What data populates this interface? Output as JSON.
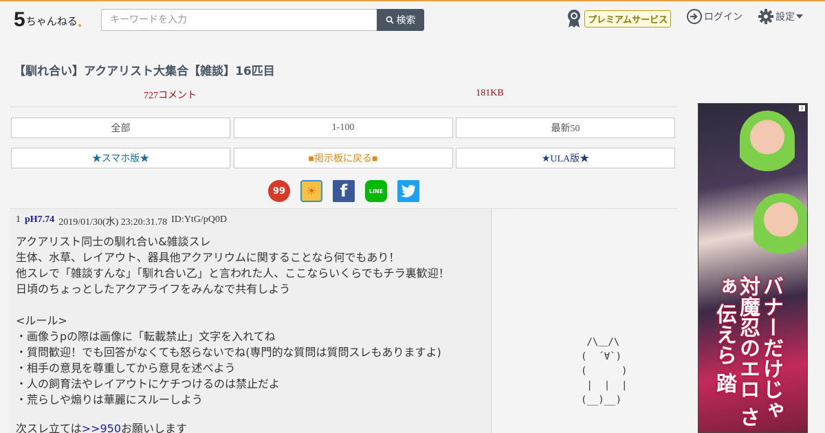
{
  "header": {
    "logo_five": "5",
    "logo_text": "ちゃんねる",
    "search_placeholder": "キーワードを入力",
    "search_button": "検索",
    "premium_label": "プレミアムサービス",
    "login_label": "ログイン",
    "settings_label": "設定"
  },
  "thread": {
    "title": "【馴れ合い】アクアリスト大集合【雑談】16匹目",
    "comments": "727コメント",
    "size": "181KB"
  },
  "nav_buttons": [
    "全部",
    "1-100",
    "最新50"
  ],
  "nav_buttons2": [
    {
      "label": "★スマホ版★",
      "color": "#1a6fa0"
    },
    {
      "label": "■掲示板に戻る■",
      "color": "#e0891a"
    },
    {
      "label": "★ULA版★",
      "color": "#1a3a8a"
    }
  ],
  "share_icons": [
    {
      "name": "99-icon",
      "text": "99",
      "color": "#d83a2a"
    },
    {
      "name": "sun-icon",
      "text": "☀",
      "color": "#e8a020"
    },
    {
      "name": "facebook-icon",
      "text": "f",
      "color": "#3b5998"
    },
    {
      "name": "line-icon",
      "text": "LINE",
      "color": "#00b900"
    },
    {
      "name": "twitter-icon",
      "text": "✓",
      "color": "#1da1f2"
    }
  ],
  "post": {
    "number": "1",
    "name": "pH7.74",
    "date": "2019/01/30(水) 23:20:31.78",
    "id": "ID:YtG/pQ0D",
    "lines": [
      "アクアリスト同士の馴れ合い&雑談スレ",
      "生体、水草、レイアウト、器具他アクアリウムに関することなら何でもあり！",
      "他スレで「雑談すんな」「馴れ合い乙」と言われた人、ここならいくらでもチラ裏歓迎！",
      "日頃のちょっとしたアクアライフをみんなで共有しよう",
      "",
      "<ルール>",
      "・画像うpの際は画像に「転載禁止」文字を入れてね",
      "・質問歓迎！でも回答がなくても怒らないでね(専門的な質問は質問スレもありますよ)",
      "・相手の意見を尊重してから意見を述べよう",
      "・人の飼育法やレイアウトにケチつけるのは禁止だよ",
      "・荒らしや煽りは華麗にスルーしよう",
      ""
    ],
    "last_prefix": "次スレ立ては",
    "last_link": ">>950",
    "last_suffix": "お願いします"
  },
  "ascii_art": " /\\＿/\\\n(  ´∀`)\n(      )\n |  |  |\n(__)__)",
  "ad": {
    "info": "i",
    "vertical_text": "バナーだけじゃ 対魔忍のエロ さぁ 伝えら 踏"
  }
}
